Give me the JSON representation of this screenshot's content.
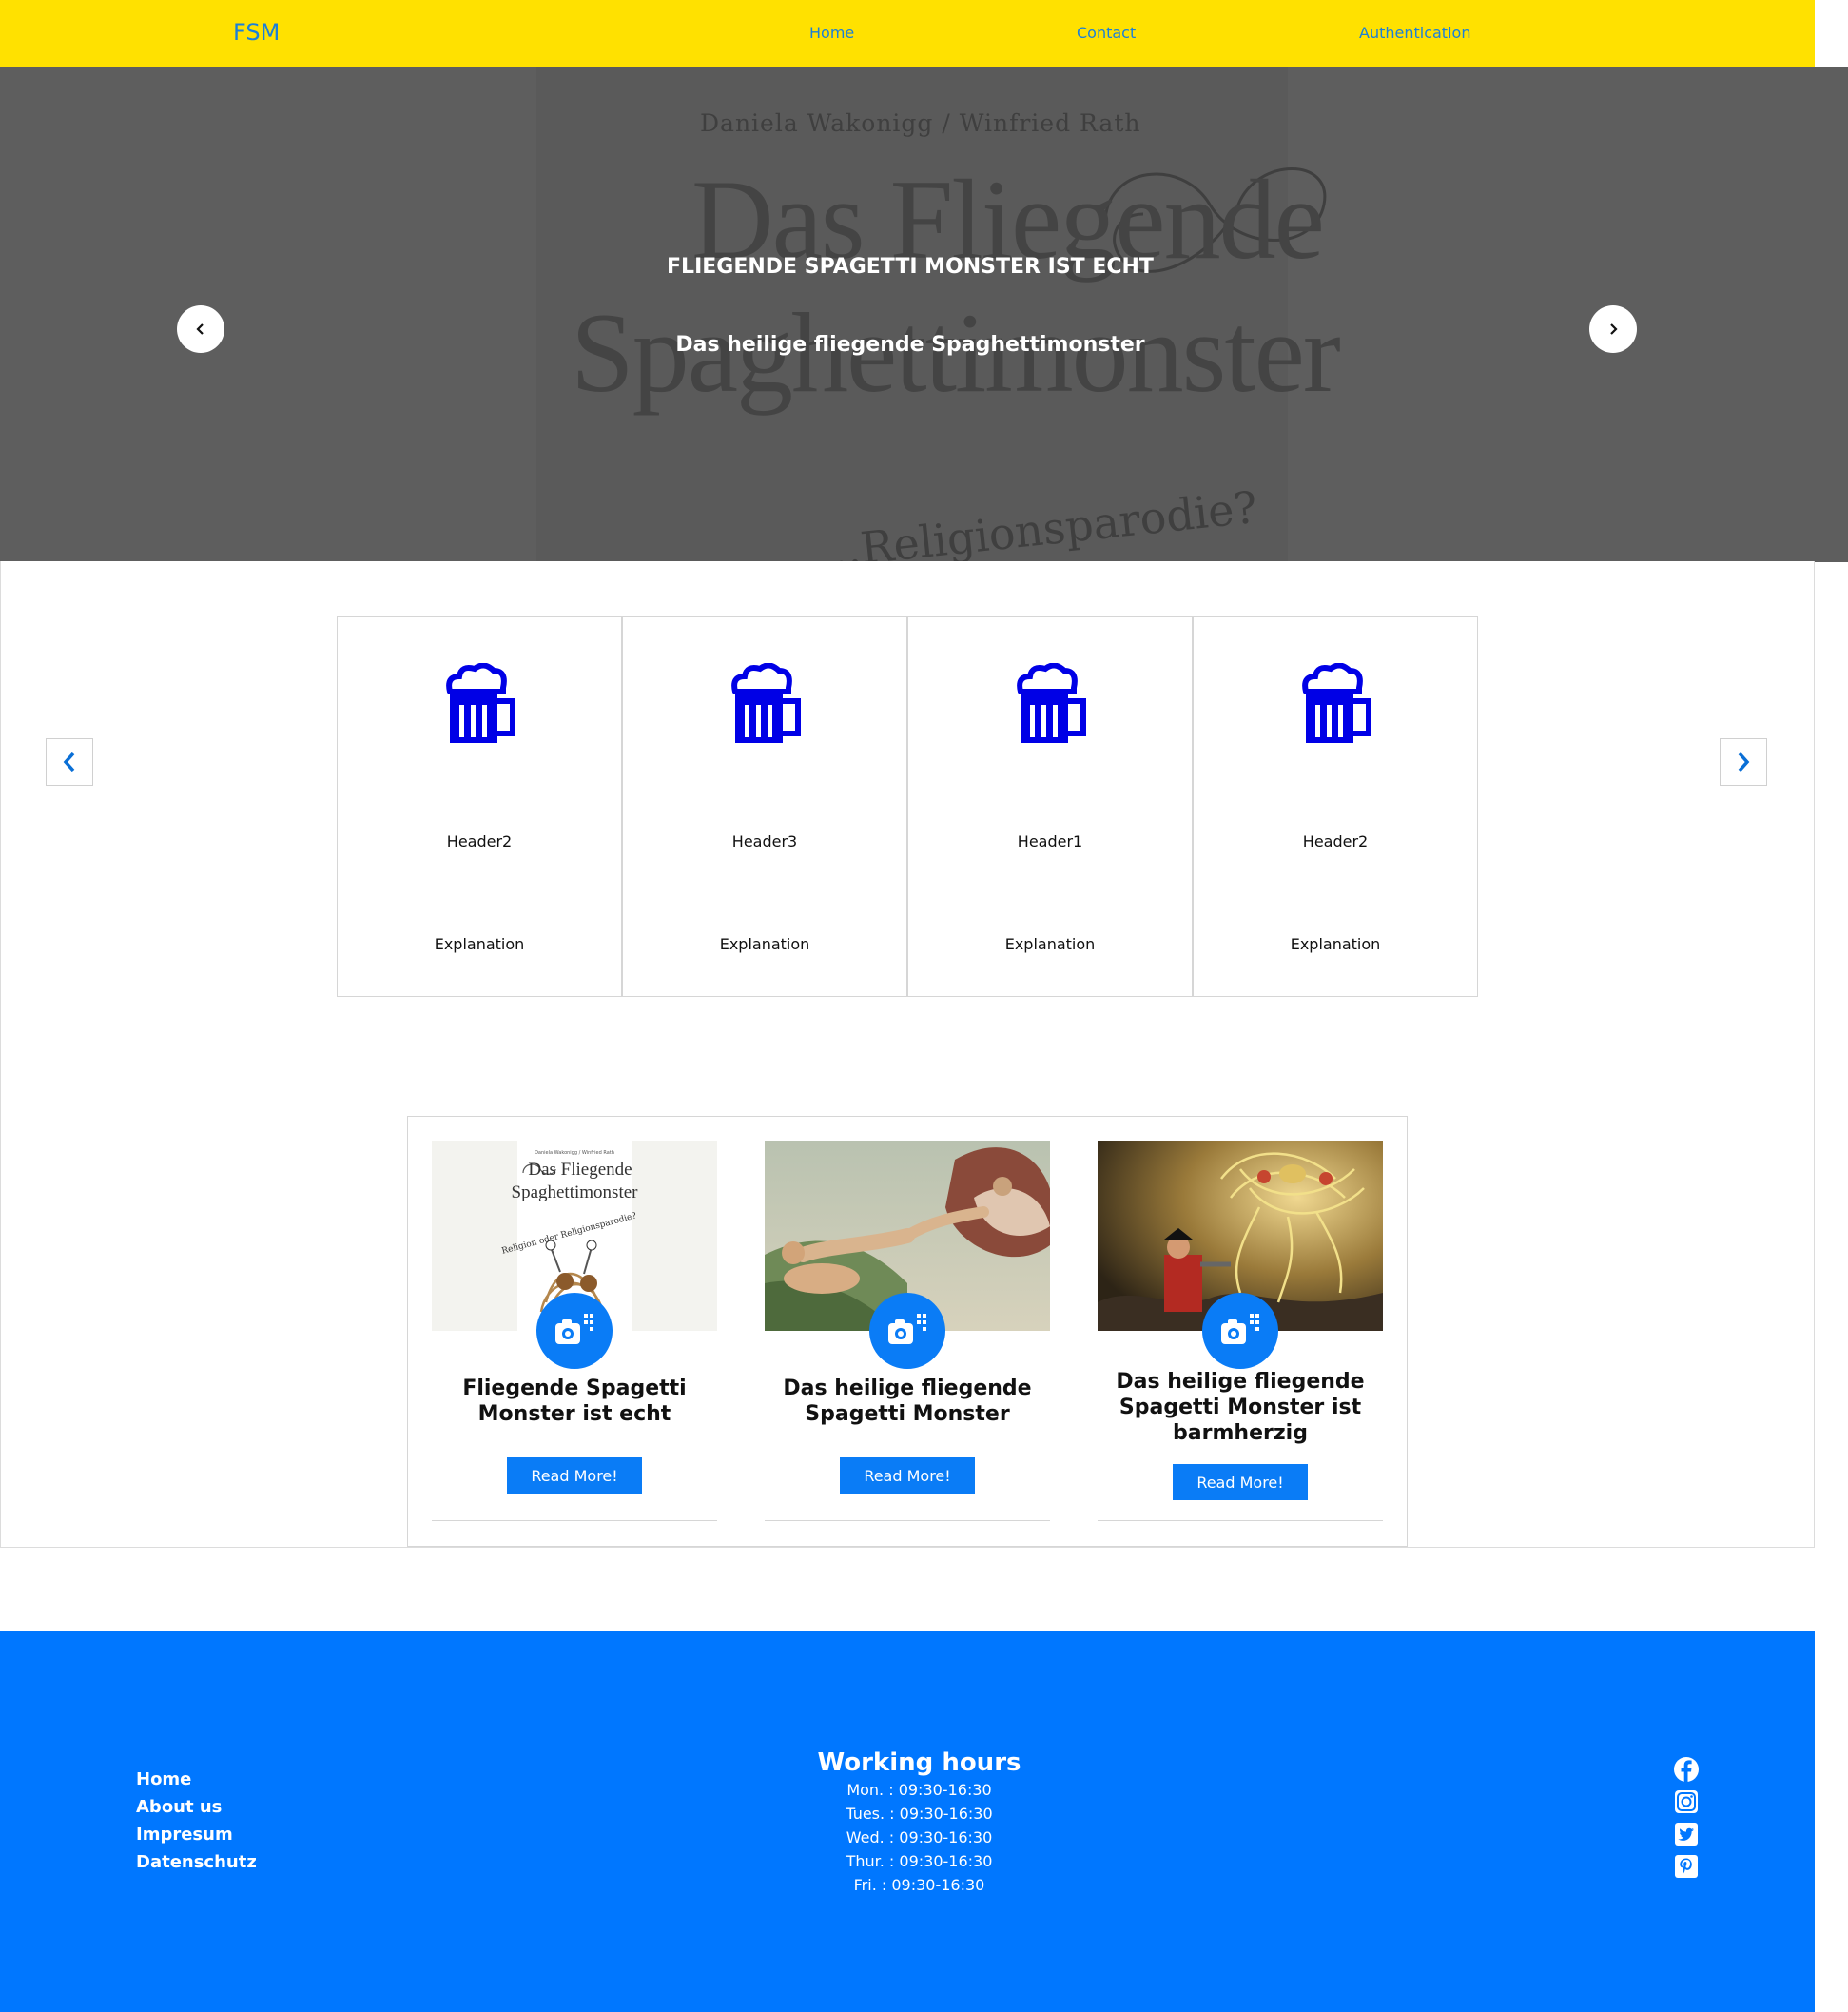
{
  "navbar": {
    "brand": "FSM",
    "links": [
      "Home",
      "Contact",
      "Authentication"
    ],
    "background": "#ffe100",
    "link_color": "#1a7fd9"
  },
  "hero": {
    "cover_author": "Daniela Wakonigg / Winfried Rath",
    "cover_title_line1": "Das Fliegende",
    "cover_title_line2": "Spaghettimonster",
    "cover_subtitle": "...Religionsparodie?",
    "heading": "FLIEGENDE SPAGETTI MONSTER IST ECHT",
    "subheading": "Das heilige fliegende Spaghettimonster",
    "prev_icon": "chevron-left-icon",
    "next_icon": "chevron-right-icon"
  },
  "features": {
    "icon": "beer-mug-icon",
    "icon_color": "#0000e6",
    "cards": [
      {
        "header": "Header2",
        "text": "Explanation"
      },
      {
        "header": "Header3",
        "text": "Explanation"
      },
      {
        "header": "Header1",
        "text": "Explanation"
      },
      {
        "header": "Header2",
        "text": "Explanation"
      }
    ]
  },
  "blog": {
    "badge_icon": "camera-icon",
    "cards": [
      {
        "title": "Fliegende Spagetti Monster ist echt",
        "button": "Read More!",
        "image": "book-cover"
      },
      {
        "title": "Das heilige fliegende Spagetti Monster",
        "button": "Read More!",
        "image": "creation-of-adam"
      },
      {
        "title": "Das heilige fliegende Spagetti Monster ist barmherzig",
        "button": "Read More!",
        "image": "pirate-and-fsm"
      }
    ],
    "accent": "#0a7cf6"
  },
  "footer": {
    "background": "#0077ff",
    "links": [
      "Home",
      "About us",
      "Impresum",
      "Datenschutz"
    ],
    "working_hours_title": "Working hours",
    "hours": [
      "Mon. : 09:30-16:30",
      "Tues. : 09:30-16:30",
      "Wed. : 09:30-16:30",
      "Thur. : 09:30-16:30",
      "Fri. : 09:30-16:30"
    ],
    "social_icons": [
      "facebook-icon",
      "instagram-icon",
      "twitter-icon",
      "pinterest-icon"
    ]
  }
}
